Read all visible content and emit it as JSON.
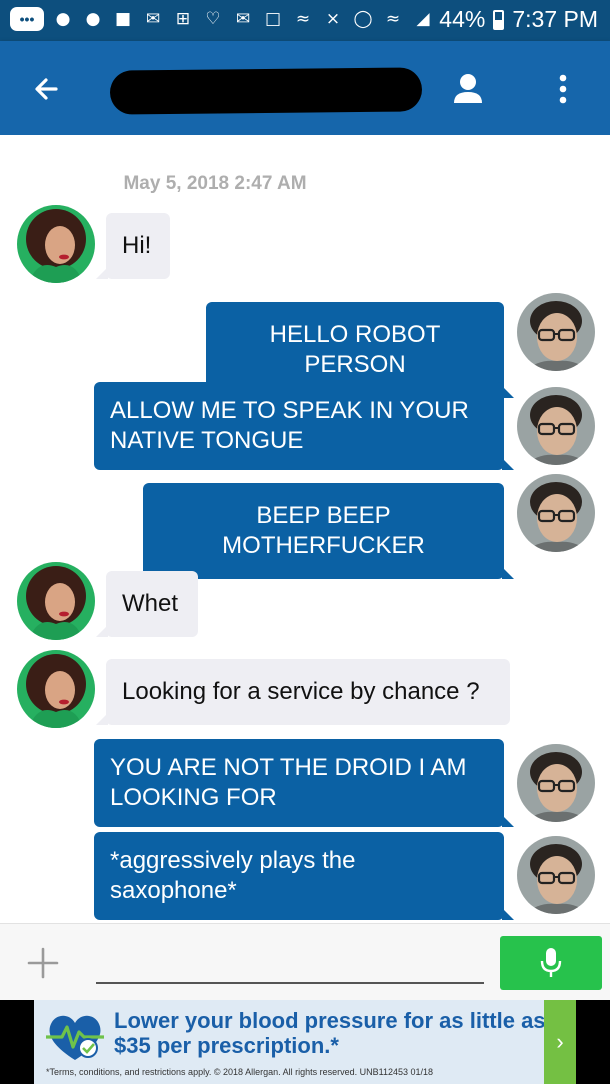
{
  "status_bar": {
    "battery": "44%",
    "time": "7:37 PM",
    "notification_icons": [
      "more-icon",
      "snapchat-icon",
      "messenger-icon",
      "chat-icon",
      "gmail-icon",
      "plus-app-icon",
      "heart-icon",
      "gmail-icon",
      "message-icon",
      "wifi-icon",
      "mute-icon",
      "alarm-icon",
      "wifi-signal-icon",
      "cell-signal-icon"
    ]
  },
  "app_bar": {
    "color": "#1666ab",
    "contact_name": "[redacted]"
  },
  "conversation": {
    "timestamp": "May 5, 2018 2:47 AM",
    "messages": [
      {
        "side": "in",
        "text": "Hi!"
      },
      {
        "side": "out",
        "text": "HELLO ROBOT PERSON"
      },
      {
        "side": "out",
        "text": "ALLOW ME TO SPEAK IN YOUR NATIVE TONGUE"
      },
      {
        "side": "out",
        "text": "BEEP BEEP MOTHERFUCKER"
      },
      {
        "side": "in",
        "text": "Whet"
      },
      {
        "side": "in",
        "text": "Looking for a service by chance ?"
      },
      {
        "side": "out",
        "text": "YOU ARE NOT THE DROID I AM LOOKING FOR"
      },
      {
        "side": "out",
        "text": "*aggressively plays the saxophone*"
      }
    ]
  },
  "composer": {
    "input_value": "",
    "input_placeholder": ""
  },
  "ad": {
    "headline": "Lower your blood pressure for as little as $35 per prescription.*",
    "fine_print": "*Terms, conditions, and restrictions apply. © 2018 Allergan. All rights reserved. UNB112453 01/18",
    "arrow": "›"
  }
}
